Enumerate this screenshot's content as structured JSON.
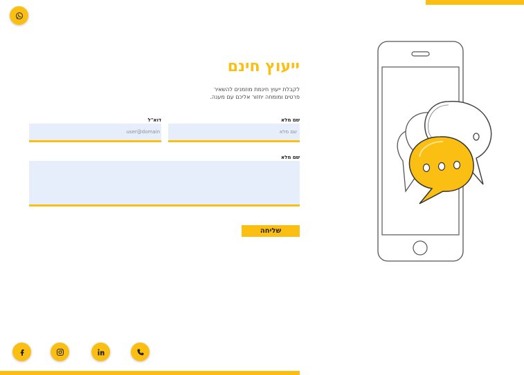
{
  "header": {
    "whatsapp_icon": "whatsapp-icon"
  },
  "contact": {
    "title": "ייעוץ חינם",
    "subtitle_line1": "לקבלת ייעוץ חינמת מוזמנים להשאיר",
    "subtitle_line2": "פרטים ומומחה יחזור אליכם עם מענה.",
    "fields": {
      "name_label": "שם מלא",
      "name_placeholder": "שם מלא",
      "email_label": "דוא\"ל",
      "email_placeholder": "user@domain",
      "message_label": "שם מלא",
      "message_placeholder": ""
    },
    "send_label": "שליחה"
  },
  "social": [
    {
      "name": "facebook",
      "icon": "facebook-icon"
    },
    {
      "name": "instagram",
      "icon": "instagram-icon"
    },
    {
      "name": "linkedin",
      "icon": "linkedin-icon"
    },
    {
      "name": "phone",
      "icon": "phone-icon"
    }
  ],
  "colors": {
    "accent": "#fbbf14",
    "field_bg": "#e6eefc",
    "text": "#222222"
  }
}
